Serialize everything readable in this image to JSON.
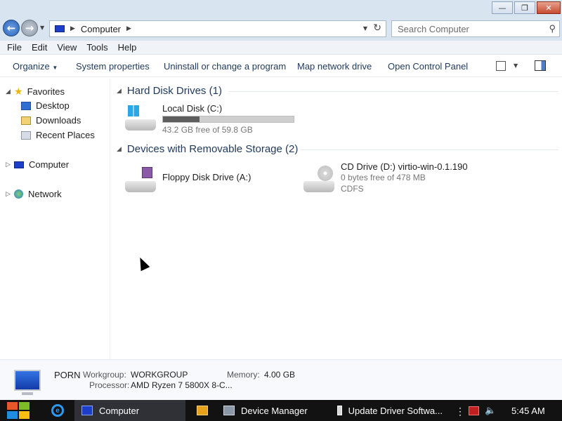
{
  "window": {
    "caption_buttons": {
      "minimize": "—",
      "restore": "❐",
      "close": "✕"
    }
  },
  "nav": {
    "back_icon": "arrow-left-icon",
    "forward_icon": "arrow-right-icon",
    "address": {
      "location": "Computer"
    },
    "search_placeholder": "Search Computer"
  },
  "menu": [
    "File",
    "Edit",
    "View",
    "Tools",
    "Help"
  ],
  "toolbar": {
    "organize": "Organize",
    "system_properties": "System properties",
    "uninstall": "Uninstall or change a program",
    "map_drive": "Map network drive",
    "control_panel": "Open Control Panel"
  },
  "sidebar": {
    "favorites": "Favorites",
    "desktop": "Desktop",
    "downloads": "Downloads",
    "recent": "Recent Places",
    "computer": "Computer",
    "network": "Network"
  },
  "groups": {
    "hdd": {
      "title": "Hard Disk Drives (1)",
      "drives": [
        {
          "name": "Local Disk (C:)",
          "free": "43.2 GB free of 59.8 GB",
          "used_fraction": 0.28
        }
      ]
    },
    "removable": {
      "title": "Devices with Removable Storage (2)",
      "drives": [
        {
          "name": "Floppy Disk Drive (A:)"
        },
        {
          "name": "CD Drive (D:) virtio-win-0.1.190",
          "free": "0 bytes free of 478 MB",
          "fs": "CDFS"
        }
      ]
    }
  },
  "details": {
    "name": "PORN",
    "workgroup_label": "Workgroup:",
    "workgroup": "WORKGROUP",
    "memory_label": "Memory:",
    "memory": "4.00 GB",
    "processor_label": "Processor:",
    "processor": "AMD Ryzen 7 5800X 8-C..."
  },
  "taskbar": {
    "items": [
      "Computer",
      "Device Manager",
      "Update Driver Softwa..."
    ],
    "clock": "5:45 AM",
    "accent": "#121212"
  }
}
